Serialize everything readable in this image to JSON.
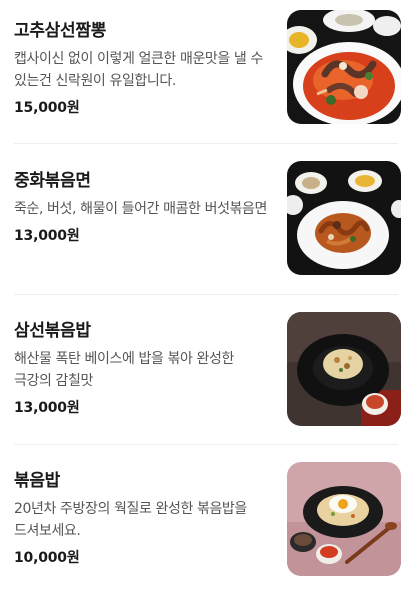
{
  "menu": {
    "items": [
      {
        "name": "고추삼선짬뽕",
        "description": "캡사이신 없이 이렇게 얼큰한 매운맛을 낼 수 있는건 신락원이 유일합니다.",
        "price": "15,000원",
        "photo_icon": "spicy-seafood-noodle-soup-photo"
      },
      {
        "name": "중화볶음면",
        "description": "죽순, 버섯, 해물이 들어간 매콤한 버섯볶음면",
        "price": "13,000원",
        "photo_icon": "stir-fried-noodle-photo"
      },
      {
        "name": "삼선볶음밥",
        "description": "해산물 폭탄 베이스에 밥을 볶아 완성한 극강의 감칠맛",
        "price": "13,000원",
        "photo_icon": "seafood-fried-rice-photo"
      },
      {
        "name": "볶음밥",
        "description": "20년차 주방장의 웍질로 완성한 볶음밥을 드셔보세요.",
        "price": "10,000원",
        "photo_icon": "fried-rice-with-egg-photo"
      }
    ]
  }
}
